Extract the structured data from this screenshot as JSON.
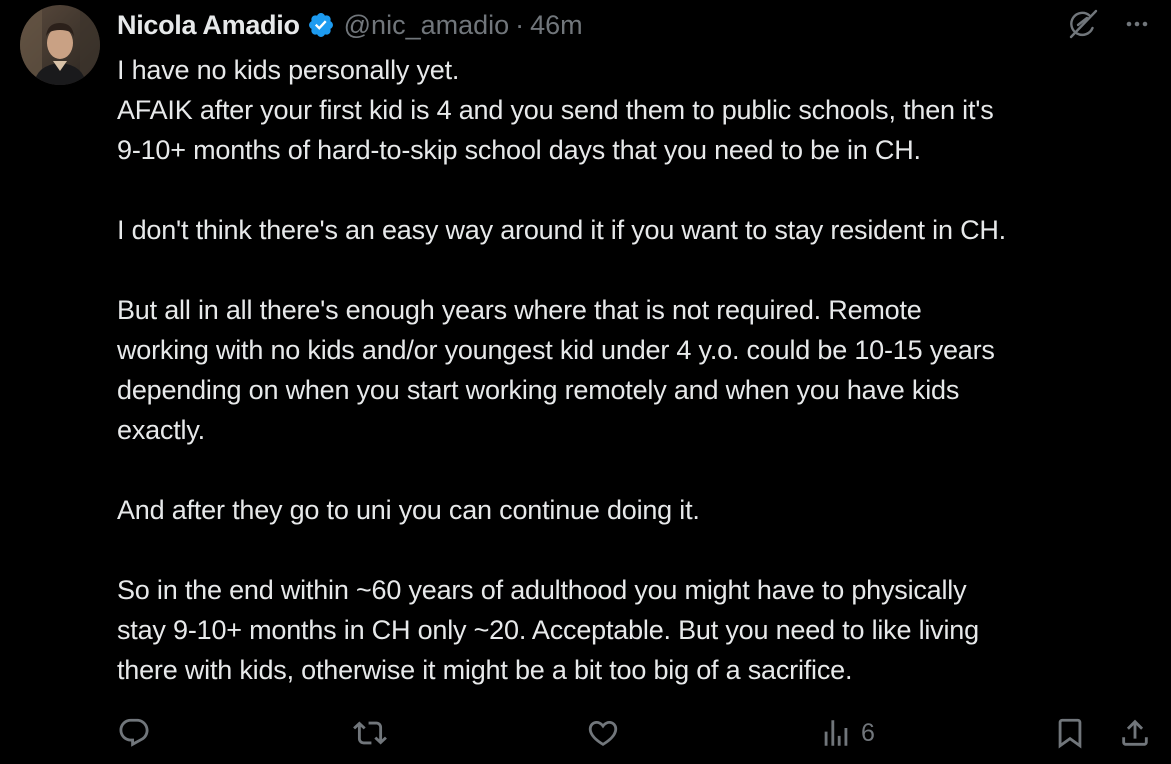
{
  "post": {
    "author_name": "Nicola Amadio",
    "handle": "@nic_amadio",
    "separator": "·",
    "time": "46m",
    "paragraphs": [
      [
        "I have no kids personally yet.",
        "AFAIK after your first kid is 4 and you send them to public schools, then it's",
        "9-10+ months of hard-to-skip school days that you need to be in CH."
      ],
      [
        "I don't think there's an easy way around it if you want to stay resident in CH."
      ],
      [
        "But all in all there's enough years where that is not required. Remote",
        "working with no kids and/or youngest kid under 4 y.o. could be 10-15 years",
        "depending on when you start working remotely and when you have kids",
        "exactly."
      ],
      [
        "And after they go to uni you can continue doing it."
      ],
      [
        "So in the end within ~60 years of adulthood you might have to physically",
        "stay 9-10+ months in CH only ~20. Acceptable. But you need to like living",
        "there with kids, otherwise it might be a bit too big of a sacrifice."
      ]
    ]
  },
  "actions": {
    "views_count": "6"
  },
  "icons": {
    "avatar": "avatar-photo",
    "verified": "verified-badge-icon",
    "grok": "grok-icon",
    "more": "more-icon",
    "reply": "reply-icon",
    "repost": "repost-icon",
    "like": "like-icon",
    "views": "views-icon",
    "bookmark": "bookmark-icon",
    "share": "share-icon"
  },
  "colors": {
    "background": "#000000",
    "text": "#e7e9ea",
    "secondary": "#71767b",
    "verified": "#1d9bf0"
  }
}
